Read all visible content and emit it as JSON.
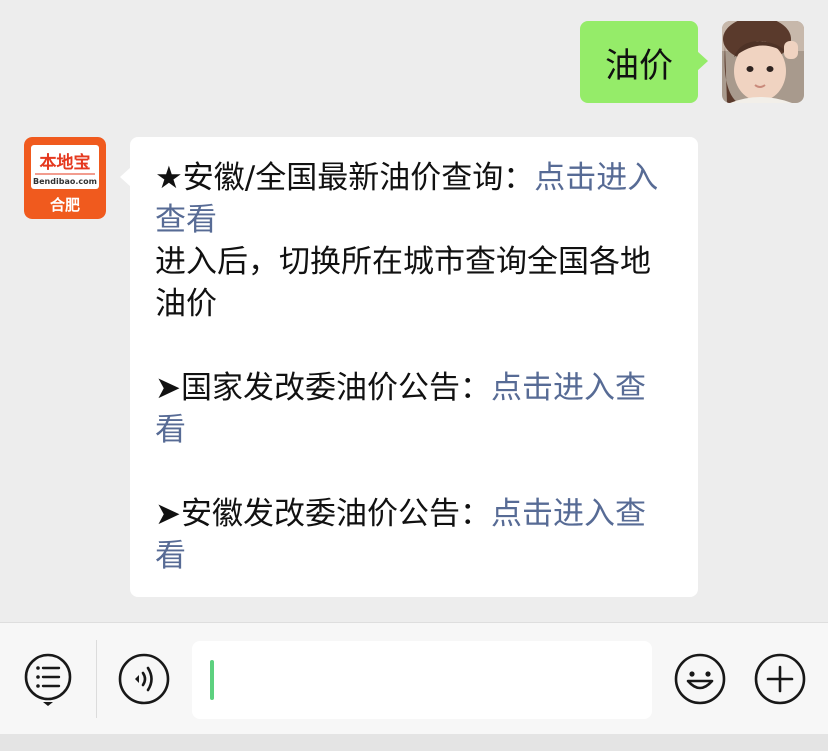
{
  "conversation": {
    "user_message": "油价",
    "reply": {
      "item1": {
        "prefix": "★安徽/全国最新油价查询：",
        "link": "点击进入查看",
        "note": "进入后，切换所在城市查询全国各地油价"
      },
      "item2": {
        "prefix": "➤国家发改委油价公告：",
        "link": "点击进入查看"
      },
      "item3": {
        "prefix": "➤安徽发改委油价公告：",
        "link": "点击进入查看"
      }
    }
  },
  "bot_avatar": {
    "logo_text": "本地宝",
    "site": "Bendibao.com",
    "city": "合肥"
  },
  "input_bar": {
    "text_value": "",
    "icons": [
      "voice-list-icon",
      "voice-icon",
      "emoji-icon",
      "plus-icon"
    ]
  },
  "colors": {
    "background": "#ededed",
    "sent_bubble": "#95ec69",
    "link": "#576b95",
    "brand_orange": "#f05a1e",
    "caret": "#5dd17f"
  }
}
